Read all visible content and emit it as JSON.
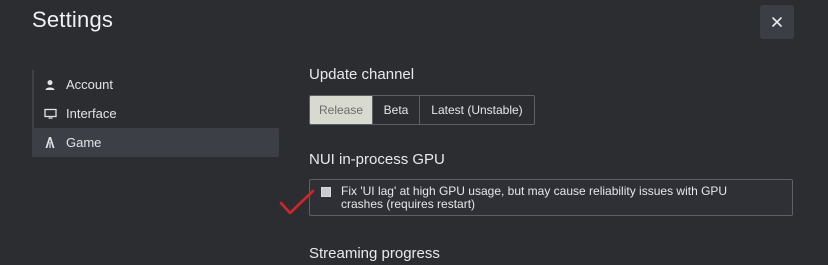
{
  "window": {
    "title": "Settings",
    "close_label": "×"
  },
  "sidebar": {
    "items": [
      {
        "label": "Account",
        "icon": "user-icon"
      },
      {
        "label": "Interface",
        "icon": "monitor-icon"
      },
      {
        "label": "Game",
        "icon": "game-logo-icon",
        "active": true
      }
    ]
  },
  "update_channel": {
    "title": "Update channel",
    "options": [
      "Release",
      "Beta",
      "Latest (Unstable)"
    ],
    "selected": "Release"
  },
  "nui_gpu": {
    "title": "NUI in-process GPU",
    "checkbox_label": "Fix 'UI lag' at high GPU usage, but may cause reliability issues with GPU crashes (requires restart)"
  },
  "streaming": {
    "title": "Streaming progress"
  },
  "colors": {
    "background": "#2b2d31",
    "active_item": "#3c3f45",
    "selected_segment": "#d8dad0",
    "checkmark_annotation": "#d0262b"
  }
}
